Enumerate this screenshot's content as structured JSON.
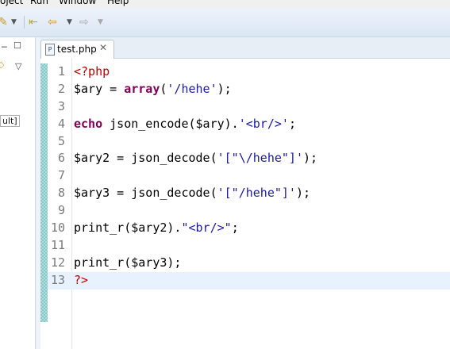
{
  "menu": [
    "oject",
    "Run",
    "Window",
    "Help"
  ],
  "toolbar_icons": [
    "pencil-icon",
    "dropdown-icon",
    "back-icon",
    "dropdown-icon",
    "forward-icon",
    "dropdown-icon"
  ],
  "left_panel": {
    "label": "ult]"
  },
  "tab": {
    "title": "test.php",
    "close": "✕",
    "file_icon_letter": "P"
  },
  "code": {
    "current_line": 13,
    "lines": [
      {
        "n": "1",
        "tokens": [
          {
            "t": "<?php",
            "c": "php"
          }
        ]
      },
      {
        "n": "2",
        "tokens": [
          {
            "t": "$ary",
            "c": "var"
          },
          {
            "t": " = ",
            "c": "plain"
          },
          {
            "t": "array",
            "c": "kw"
          },
          {
            "t": "(",
            "c": "plain"
          },
          {
            "t": "'/hehe'",
            "c": "str"
          },
          {
            "t": ");",
            "c": "plain"
          }
        ]
      },
      {
        "n": "3",
        "tokens": []
      },
      {
        "n": "4",
        "tokens": [
          {
            "t": "echo",
            "c": "kw"
          },
          {
            "t": " json_encode(",
            "c": "plain"
          },
          {
            "t": "$ary",
            "c": "var"
          },
          {
            "t": ").",
            "c": "plain"
          },
          {
            "t": "'<br/>'",
            "c": "str"
          },
          {
            "t": ";",
            "c": "plain"
          }
        ]
      },
      {
        "n": "5",
        "tokens": []
      },
      {
        "n": "6",
        "tokens": [
          {
            "t": "$ary2",
            "c": "var"
          },
          {
            "t": " = json_decode(",
            "c": "plain"
          },
          {
            "t": "'[\"\\/hehe\"]'",
            "c": "str"
          },
          {
            "t": ");",
            "c": "plain"
          }
        ]
      },
      {
        "n": "7",
        "tokens": []
      },
      {
        "n": "8",
        "tokens": [
          {
            "t": "$ary3",
            "c": "var"
          },
          {
            "t": " = json_decode(",
            "c": "plain"
          },
          {
            "t": "'[\"/hehe\"]'",
            "c": "str"
          },
          {
            "t": ");",
            "c": "plain"
          }
        ]
      },
      {
        "n": "9",
        "tokens": []
      },
      {
        "n": "10",
        "tokens": [
          {
            "t": "print_r(",
            "c": "plain"
          },
          {
            "t": "$ary2",
            "c": "var"
          },
          {
            "t": ").",
            "c": "plain"
          },
          {
            "t": "\"<br/>\"",
            "c": "str"
          },
          {
            "t": ";",
            "c": "plain"
          }
        ]
      },
      {
        "n": "11",
        "tokens": []
      },
      {
        "n": "12",
        "tokens": [
          {
            "t": "print_r(",
            "c": "plain"
          },
          {
            "t": "$ary3",
            "c": "var"
          },
          {
            "t": ");",
            "c": "plain"
          }
        ]
      },
      {
        "n": "13",
        "tokens": [
          {
            "t": "?>",
            "c": "php"
          }
        ]
      }
    ]
  }
}
